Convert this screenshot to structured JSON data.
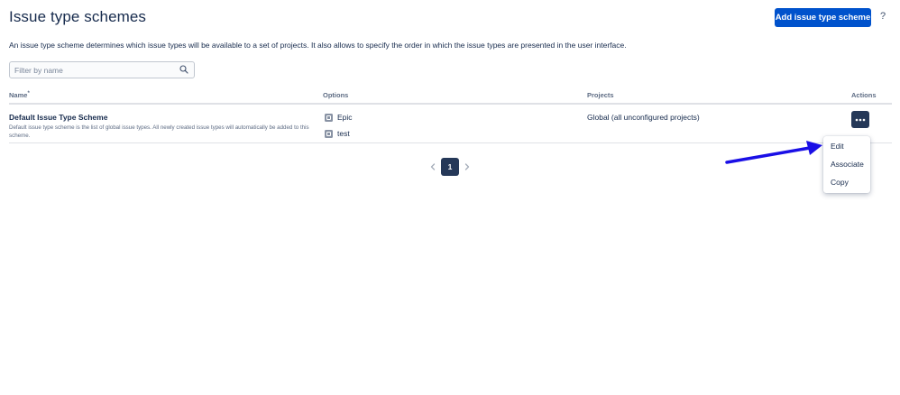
{
  "page": {
    "title": "Issue type schemes",
    "add_button_label": "Add issue type scheme",
    "help_label": "?",
    "description": "An issue type scheme determines which issue types will be available to a set of projects. It also allows to specify the order in which the issue types are presented in the user interface."
  },
  "filter": {
    "placeholder": "Filter by name",
    "value": "",
    "icon": "search-icon"
  },
  "table": {
    "columns": [
      "Name",
      "Options",
      "Projects",
      "Actions"
    ],
    "sort_indicator": "*",
    "rows": [
      {
        "name": "Default Issue Type Scheme",
        "description": "Default issue type scheme is the list of global issue types. All newly created issue types will automatically be added to this scheme.",
        "options": [
          {
            "label": "Epic",
            "icon": "issue-type-icon"
          },
          {
            "label": "test",
            "icon": "issue-type-icon"
          }
        ],
        "projects": "Global (all unconfigured projects)",
        "actions_icon": "more-icon"
      }
    ]
  },
  "actions_menu": {
    "items": [
      "Edit",
      "Associate",
      "Copy"
    ]
  },
  "pagination": {
    "current_page": "1",
    "prev_icon": "chevron-left-icon",
    "next_icon": "chevron-right-icon"
  },
  "colors": {
    "primary": "#0052cc",
    "dark": "#253858",
    "text": "#172b4d",
    "annotation_arrow": "#1a0fe6"
  }
}
